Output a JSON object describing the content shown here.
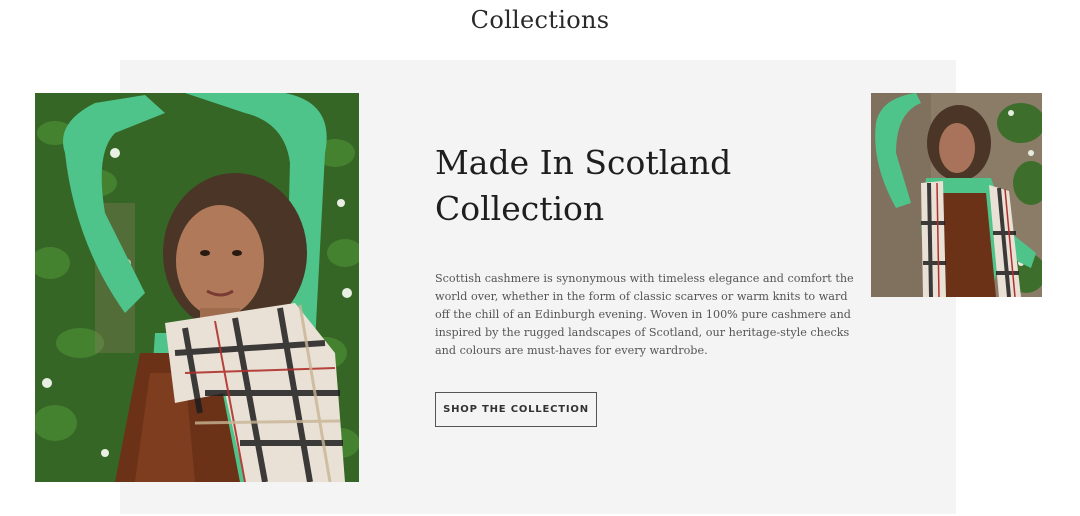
{
  "section": {
    "title": "Collections"
  },
  "feature": {
    "headline": "Made In Scotland Collection",
    "description": "Scottish cashmere is synonymous with timeless elegance and comfort the world over, whether in the form of classic scarves or warm knits to ward off the chill of an Edinburgh evening. Woven in 100% pure cashmere and inspired by the rugged landscapes of Scotland, our heritage-style checks and colours are must-haves for every wardrobe.",
    "cta_label": "SHOP THE COLLECTION"
  },
  "images": {
    "main": "model-green-top-check-scarf-photo",
    "side": "model-check-scarf-stone-wall-photo"
  },
  "colors": {
    "panel_background": "#f4f4f4",
    "top_green": "#4fc48a",
    "dress_brown": "#6b3218",
    "foliage": "#2f5e22"
  }
}
